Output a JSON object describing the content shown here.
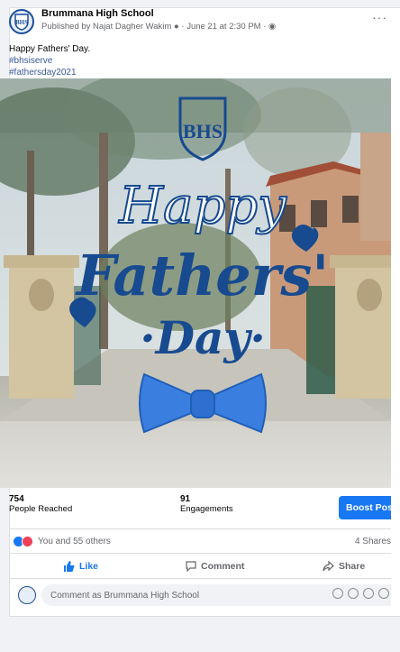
{
  "post": {
    "page_name": "Brummana High School",
    "meta_prefix": "Published by",
    "publisher": "Najat Dagher Wakim",
    "date": "June 21 at 2:30 PM",
    "more_label": "···",
    "caption": "Happy Fathers' Day.",
    "hashtags": [
      "#bhsiserve",
      "#fathersday2021"
    ]
  },
  "image": {
    "logo_text": "BHS",
    "line1": "Happy",
    "line2": "Fathers'",
    "line3": "·Day·",
    "colors": {
      "script": "#174a8f",
      "bow": "#3a7ee0"
    }
  },
  "insights": {
    "reach_value": "754",
    "reach_label": "People Reached",
    "engagement_value": "91",
    "engagement_label": "Engagements",
    "boost_label": "Boost Post"
  },
  "reactions": {
    "text": "You and 55 others",
    "shares": "4 Shares"
  },
  "actions": {
    "like": "Like",
    "comment": "Comment",
    "share": "Share"
  },
  "comment_box": {
    "placeholder": "Comment as Brummana High School"
  },
  "colors": {
    "accent": "#1877f2",
    "love": "#f33e58"
  }
}
